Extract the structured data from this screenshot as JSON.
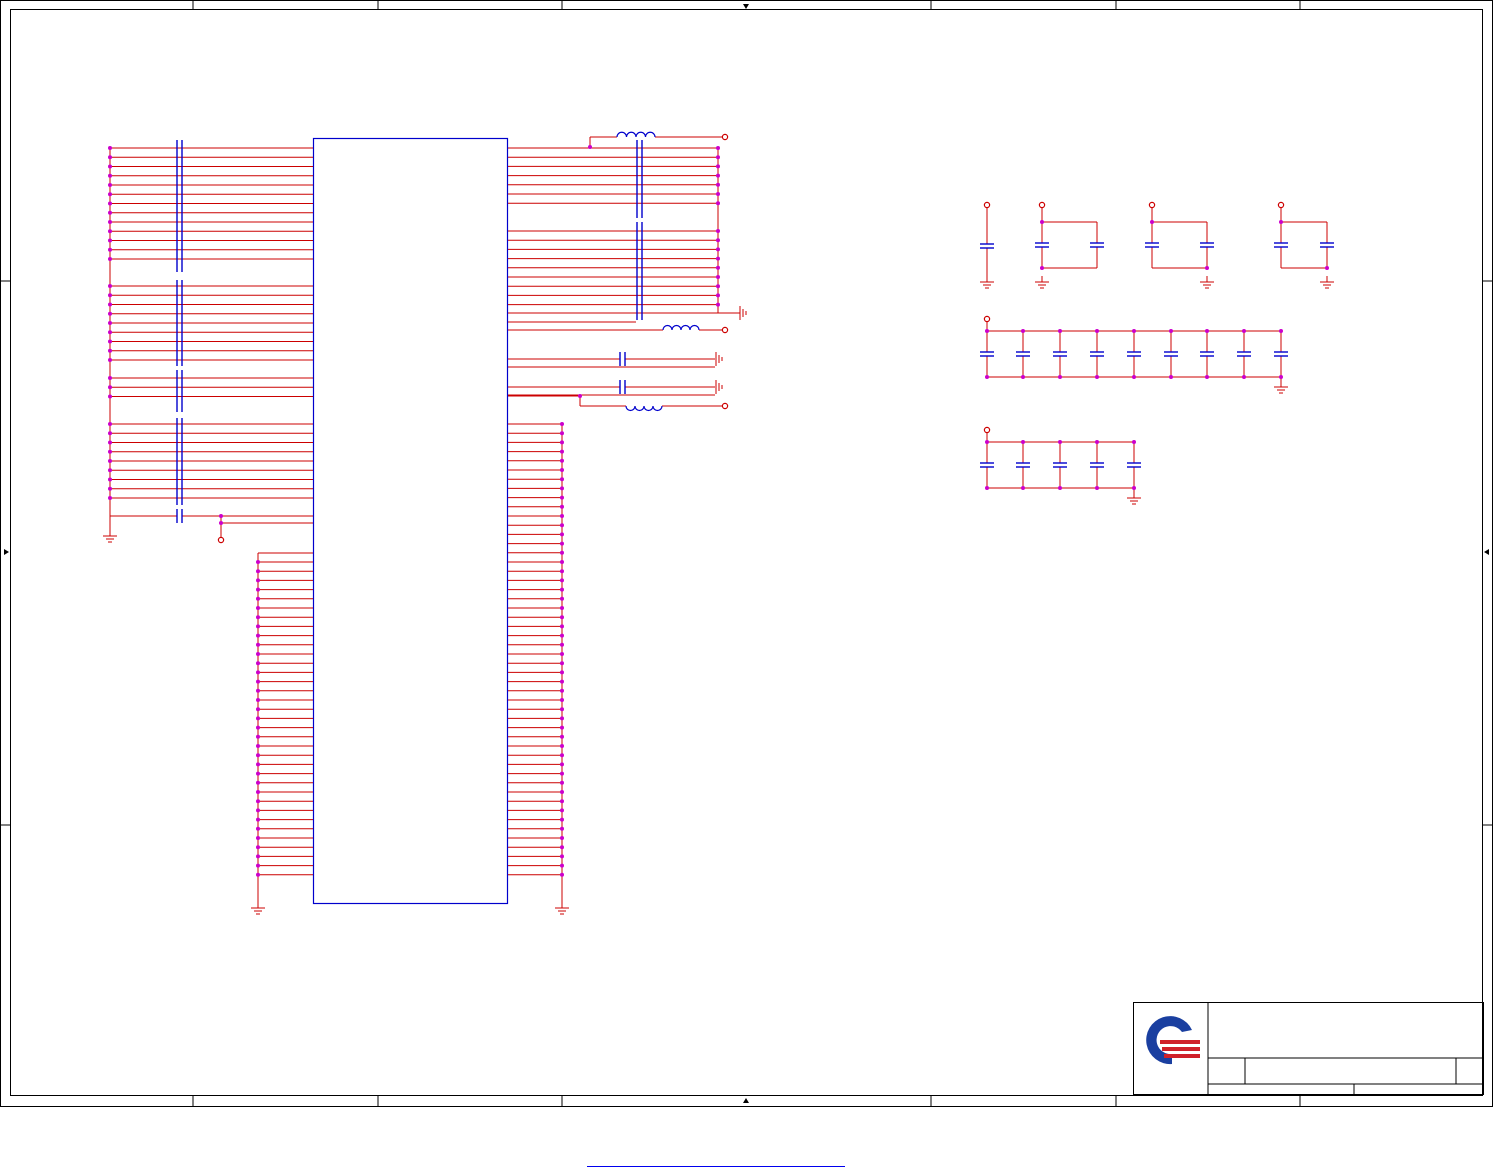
{
  "drawing": {
    "colors": {
      "frame": "#000000",
      "wire": "#cc0000",
      "component": "#0000cc",
      "junction": "#cc00cc",
      "ground": "#cc0000",
      "logo_blue": "#1a3fa0",
      "logo_red": "#d0202a"
    },
    "text_labels": [],
    "footer_link": ""
  }
}
